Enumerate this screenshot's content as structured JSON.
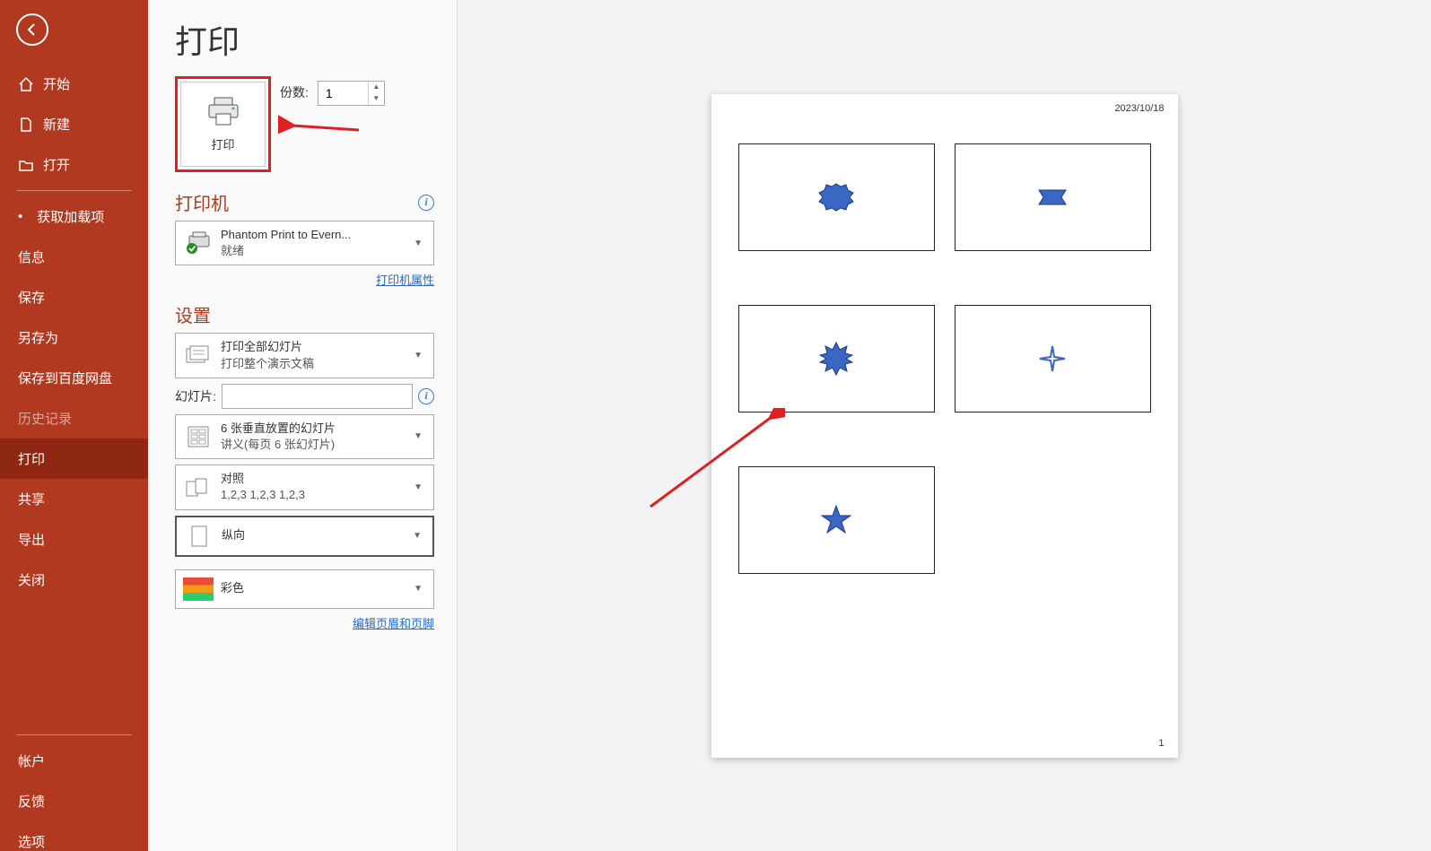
{
  "sidebar": {
    "home": "开始",
    "new": "新建",
    "open": "打开",
    "addins": "获取加载项",
    "info": "信息",
    "save": "保存",
    "saveas": "另存为",
    "savebaidu": "保存到百度网盘",
    "history": "历史记录",
    "print": "打印",
    "share": "共享",
    "export": "导出",
    "close": "关闭",
    "account": "帐户",
    "feedback": "反馈",
    "options": "选项"
  },
  "page": {
    "title": "打印"
  },
  "print_button": {
    "label": "打印"
  },
  "copies": {
    "label": "份数:",
    "value": "1"
  },
  "printer": {
    "section": "打印机",
    "name": "Phantom Print to Evern...",
    "status": "就绪",
    "props_link": "打印机属性"
  },
  "settings": {
    "section": "设置",
    "range_title": "打印全部幻灯片",
    "range_sub": "打印整个演示文稿",
    "slides_label": "幻灯片:",
    "layout_title": "6 张垂直放置的幻灯片",
    "layout_sub": "讲义(每页 6 张幻灯片)",
    "collate_title": "对照",
    "collate_sub": "1,2,3    1,2,3    1,2,3",
    "orientation": "纵向",
    "color": "彩色",
    "header_footer_link": "编辑页眉和页脚"
  },
  "preview": {
    "date": "2023/10/18",
    "page_num": "1"
  }
}
